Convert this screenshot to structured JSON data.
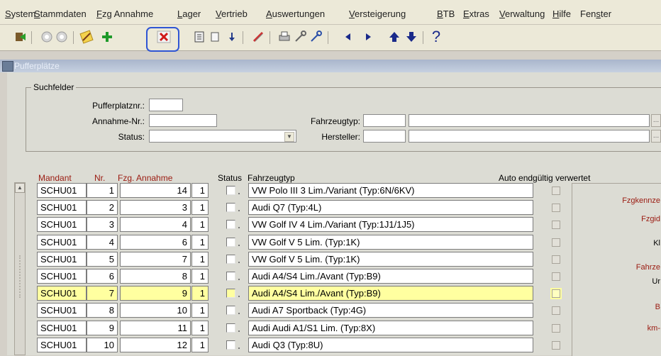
{
  "menu": [
    {
      "pre": "",
      "u": "S",
      "post": "ystem"
    },
    {
      "pre": "",
      "u": "S",
      "post": "tammdaten"
    },
    {
      "pre": "",
      "u": "F",
      "post": "zg Annahme"
    },
    {
      "pre": "",
      "u": "L",
      "post": "ager"
    },
    {
      "pre": "",
      "u": "V",
      "post": "ertrieb"
    },
    {
      "pre": "",
      "u": "A",
      "post": "uswertungen"
    },
    {
      "pre": "",
      "u": "V",
      "post": "ersteigerung"
    },
    {
      "pre": "",
      "u": "B",
      "post": "TB"
    },
    {
      "pre": "",
      "u": "E",
      "post": "xtras"
    },
    {
      "pre": "",
      "u": "V",
      "post": "erwaltung"
    },
    {
      "pre": "",
      "u": "H",
      "post": "ilfe"
    },
    {
      "pre": "Fen",
      "u": "s",
      "post": "ter"
    }
  ],
  "toolbar": {
    "icons": [
      "exit-icon",
      "back-icon",
      "forward-icon",
      "edit-icon",
      "insert-icon",
      "delete-icon",
      "query-icon",
      "clear-icon",
      "save-icon",
      "attach-icon",
      "print-icon",
      "tools-icon",
      "tools2-icon",
      "previous-icon",
      "next-icon",
      "up-icon",
      "down-icon",
      "help-icon"
    ],
    "help_glyph": "?"
  },
  "window": {
    "title": "Pufferplätze"
  },
  "search": {
    "group_label": "Suchfelder",
    "pufferplatz_label": "Pufferplatznr.:",
    "annahme_label": "Annahme-Nr.:",
    "status_label": "Status:",
    "fahrzeugtyp_label": "Fahrzeugtyp:",
    "hersteller_label": "Hersteller:",
    "ellipsis": "..."
  },
  "grid": {
    "headers": {
      "mandant": "Mandant",
      "nr": "Nr.",
      "fzg_annahme": "Fzg. Annahme",
      "status": "Status",
      "fahrzeugtyp": "Fahrzeugtyp",
      "auto": "Auto endgültig verwertet"
    },
    "selected_index": 6,
    "rows": [
      {
        "mandant": "SCHU01",
        "nr": "1",
        "annahme": "14",
        "extra": "1",
        "typ": "VW Polo III 3 Lim./Variant (Typ:6N/6KV)"
      },
      {
        "mandant": "SCHU01",
        "nr": "2",
        "annahme": "3",
        "extra": "1",
        "typ": "Audi Q7  (Typ:4L)"
      },
      {
        "mandant": "SCHU01",
        "nr": "3",
        "annahme": "4",
        "extra": "1",
        "typ": "VW Golf IV 4 Lim./Variant (Typ:1J1/1J5)"
      },
      {
        "mandant": "SCHU01",
        "nr": "4",
        "annahme": "6",
        "extra": "1",
        "typ": "VW Golf V 5 Lim. (Typ:1K)"
      },
      {
        "mandant": "SCHU01",
        "nr": "5",
        "annahme": "7",
        "extra": "1",
        "typ": "VW Golf V 5 Lim. (Typ:1K)"
      },
      {
        "mandant": "SCHU01",
        "nr": "6",
        "annahme": "8",
        "extra": "1",
        "typ": "Audi A4/S4 Lim./Avant (Typ:B9)"
      },
      {
        "mandant": "SCHU01",
        "nr": "7",
        "annahme": "9",
        "extra": "1",
        "typ": "Audi A4/S4 Lim./Avant (Typ:B9)"
      },
      {
        "mandant": "SCHU01",
        "nr": "8",
        "annahme": "10",
        "extra": "1",
        "typ": "Audi A7 Sportback (Typ:4G)"
      },
      {
        "mandant": "SCHU01",
        "nr": "9",
        "annahme": "11",
        "extra": "1",
        "typ": "Audi Audi A1/S1 Lim. (Typ:8X)"
      },
      {
        "mandant": "SCHU01",
        "nr": "10",
        "annahme": "12",
        "extra": "1",
        "typ": "Audi Q3  (Typ:8U)"
      }
    ]
  },
  "side_panel": [
    "Fzgkennze",
    "Fzgid",
    "Kl",
    "Fahrze",
    "Ur",
    "B",
    "km-"
  ],
  "colors": {
    "selected_row": "#ffffa0",
    "label_red": "#9a1a10",
    "highlight_box": "#2f55d4"
  }
}
